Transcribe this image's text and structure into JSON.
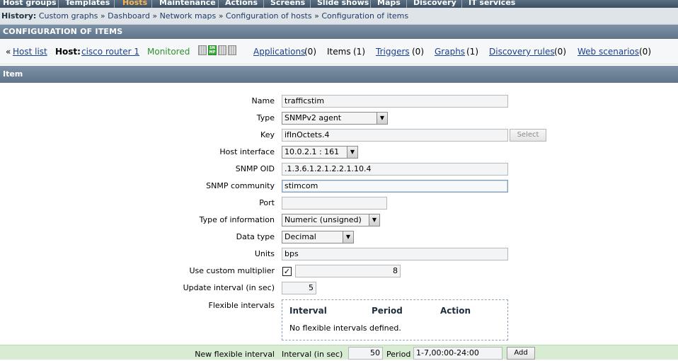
{
  "topmenu": {
    "items": [
      "Host groups",
      "Templates",
      "Hosts",
      "Maintenance",
      "Actions",
      "Screens",
      "Slide shows",
      "Maps",
      "Discovery",
      "IT services"
    ],
    "active_index": 2,
    "active_color": "#ffb54a"
  },
  "history": {
    "label": "History:",
    "links": [
      "Custom graphs",
      "Dashboard",
      "Network maps",
      "Configuration of hosts",
      "Configuration of items"
    ],
    "separator": "»"
  },
  "section_title": "CONFIGURATION OF ITEMS",
  "hostbar": {
    "back_prefix": "«",
    "host_list": "Host list",
    "host_label": "Host:",
    "host_name": "cisco router 1",
    "status": "Monitored",
    "status_color": "#2f8f2f",
    "availability": [
      {
        "name": "Z",
        "state": "gray"
      },
      {
        "name": "SNMP",
        "state": "green"
      },
      {
        "name": "JMX",
        "state": "gray"
      },
      {
        "name": "IPMI",
        "state": "gray"
      }
    ],
    "applications": "Applications",
    "applications_count": "(0)",
    "items": "Items",
    "items_count": "(1)",
    "triggers": "Triggers",
    "triggers_count": "(0)",
    "graphs": "Graphs",
    "graphs_count": "(1)",
    "discovery": "Discovery rules",
    "discovery_count": "(0)",
    "web": "Web scenarios",
    "web_count": "(0)"
  },
  "item_header": "Item",
  "form": {
    "name_label": "Name",
    "name_value": "trafficstim",
    "type_label": "Type",
    "type_value": "SNMPv2 agent",
    "key_label": "Key",
    "key_value": "ifInOctets.4",
    "select_button": "Select",
    "iface_label": "Host interface",
    "iface_value": "10.0.2.1 : 161",
    "oid_label": "SNMP OID",
    "oid_value": ".1.3.6.1.2.1.2.2.1.10.4",
    "community_label": "SNMP community",
    "community_value": "stimcom",
    "port_label": "Port",
    "port_value": "",
    "typeinfo_label": "Type of information",
    "typeinfo_value": "Numeric (unsigned)",
    "datatype_label": "Data type",
    "datatype_value": "Decimal",
    "units_label": "Units",
    "units_value": "bps",
    "multiplier_label": "Use custom multiplier",
    "multiplier_checked": "✓",
    "multiplier_value": "8",
    "interval_label": "Update interval (in sec)",
    "interval_value": "5",
    "flex_label": "Flexible intervals",
    "flex_headers": [
      "Interval",
      "Period",
      "Action"
    ],
    "flex_empty": "No flexible intervals defined.",
    "newflex_label": "New flexible interval",
    "newflex_interval_label": "Interval (in sec)",
    "newflex_interval_value": "50",
    "newflex_period_label": "Period",
    "newflex_period_value": "1-7,00:00-24:00",
    "add_button": "Add"
  }
}
